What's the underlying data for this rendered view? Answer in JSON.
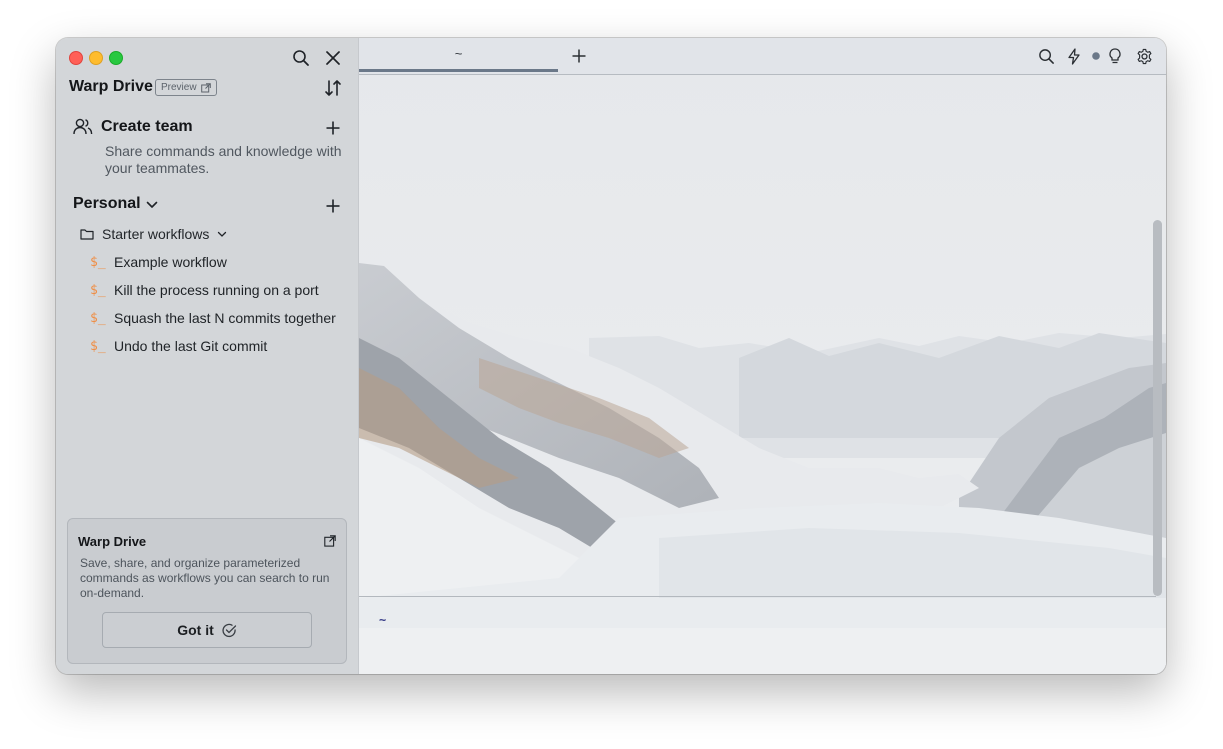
{
  "window": {
    "traffic_lights": {
      "close_color": "#ff5f57",
      "minimize_color": "#febc2e",
      "maximize_color": "#28c840"
    }
  },
  "sidebar": {
    "title": "Warp Drive",
    "preview_badge": "Preview",
    "icons": {
      "search": "search-icon",
      "close": "close-icon",
      "sort": "sort-icon"
    },
    "create_team": {
      "label": "Create team",
      "description": "Share commands and knowledge with your teammates."
    },
    "personal": {
      "label": "Personal",
      "folder": {
        "name": "Starter workflows",
        "items": [
          {
            "icon": "$_",
            "label": "Example workflow"
          },
          {
            "icon": "$_",
            "label": "Kill the process running on a port"
          },
          {
            "icon": "$_",
            "label": "Squash the last N commits together"
          },
          {
            "icon": "$_",
            "label": "Undo the last Git commit"
          }
        ]
      }
    },
    "info_card": {
      "title": "Warp Drive",
      "description": "Save, share, and organize parameterized commands as workflows you can search to run on-demand.",
      "button_label": "Got it"
    }
  },
  "terminal": {
    "tabs": [
      {
        "label": "~",
        "active": true
      }
    ],
    "prompt": "~",
    "toolbar_icons": [
      "search-icon",
      "bolt-icon",
      "status-dot-icon",
      "lightbulb-icon",
      "gear-icon"
    ],
    "accent_color": "#6b7889",
    "prompt_color": "#3b3f8a",
    "workflow_icon_color": "#ef8e45"
  }
}
